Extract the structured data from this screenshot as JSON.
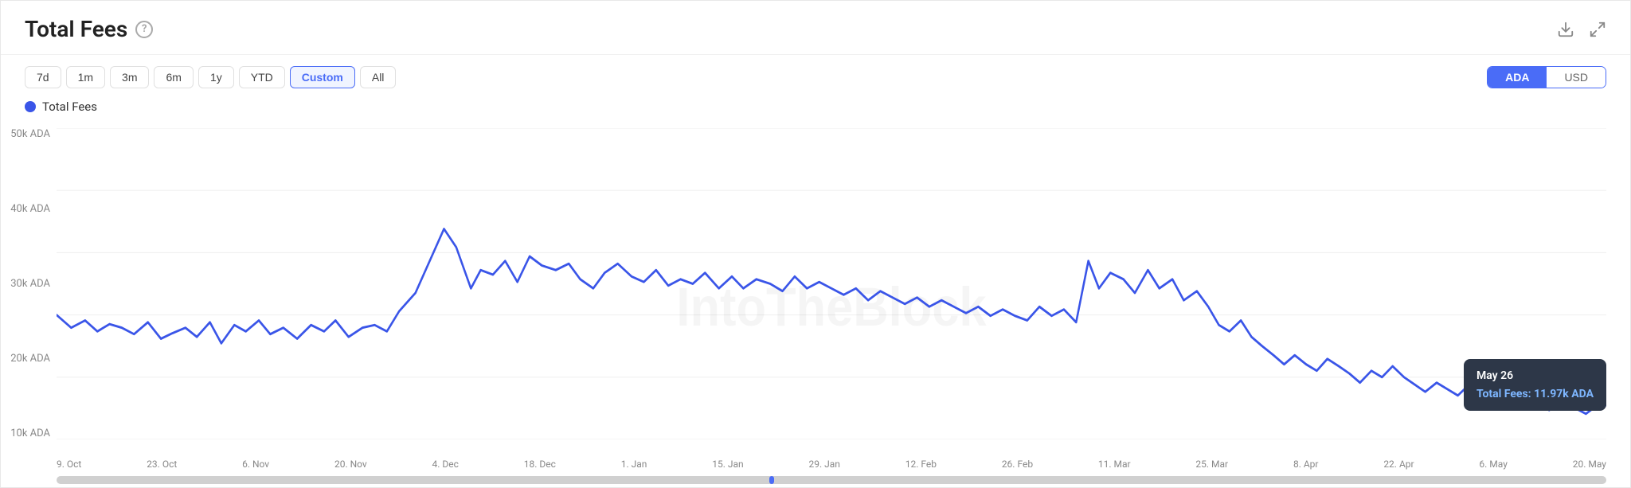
{
  "header": {
    "title": "Total Fees",
    "help_icon": "?",
    "download_icon": "⬇",
    "expand_icon": "⤢"
  },
  "time_filters": [
    {
      "label": "7d",
      "id": "7d",
      "active": false
    },
    {
      "label": "1m",
      "id": "1m",
      "active": false
    },
    {
      "label": "3m",
      "id": "3m",
      "active": false
    },
    {
      "label": "6m",
      "id": "6m",
      "active": false
    },
    {
      "label": "1y",
      "id": "1y",
      "active": false
    },
    {
      "label": "YTD",
      "id": "ytd",
      "active": false
    },
    {
      "label": "Custom",
      "id": "custom",
      "active": true
    },
    {
      "label": "All",
      "id": "all",
      "active": false
    }
  ],
  "currency": {
    "options": [
      "ADA",
      "USD"
    ],
    "active": "ADA"
  },
  "legend": {
    "label": "Total Fees",
    "color": "#3a55e8"
  },
  "y_axis": {
    "labels": [
      "50k ADA",
      "40k ADA",
      "30k ADA",
      "20k ADA",
      "10k ADA"
    ]
  },
  "x_axis": {
    "labels": [
      "9. Oct",
      "23. Oct",
      "6. Nov",
      "20. Nov",
      "4. Dec",
      "18. Dec",
      "1. Jan",
      "15. Jan",
      "29. Jan",
      "12. Feb",
      "26. Feb",
      "11. Mar",
      "25. Mar",
      "8. Apr",
      "22. Apr",
      "6. May",
      "20. May"
    ]
  },
  "tooltip": {
    "date": "May 26",
    "label": "Total Fees:",
    "value": "11.97k ADA"
  },
  "watermark": "IntoTheBlock"
}
